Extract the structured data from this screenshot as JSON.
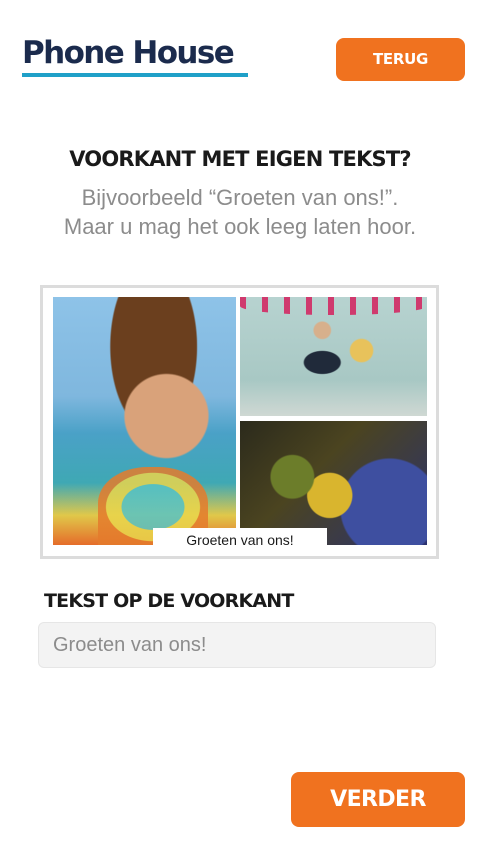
{
  "header": {
    "logo_text": "Phone House",
    "back_label": "TERUG"
  },
  "question": {
    "title": "VOORKANT MET EIGEN TEKST?",
    "hint_line1": "Bijvoorbeeld “Groeten van ons!”.",
    "hint_line2": "Maar u mag het ook leeg laten hoor."
  },
  "card_preview": {
    "caption": "Groeten van ons!"
  },
  "front_text": {
    "label": "TEKST OP DE VOORKANT",
    "value": "",
    "placeholder": "Groeten van ons!"
  },
  "footer": {
    "next_label": "VERDER"
  },
  "colors": {
    "accent": "#f0721f",
    "logo_navy": "#1b2b4d",
    "logo_underline": "#1fa0c8"
  }
}
